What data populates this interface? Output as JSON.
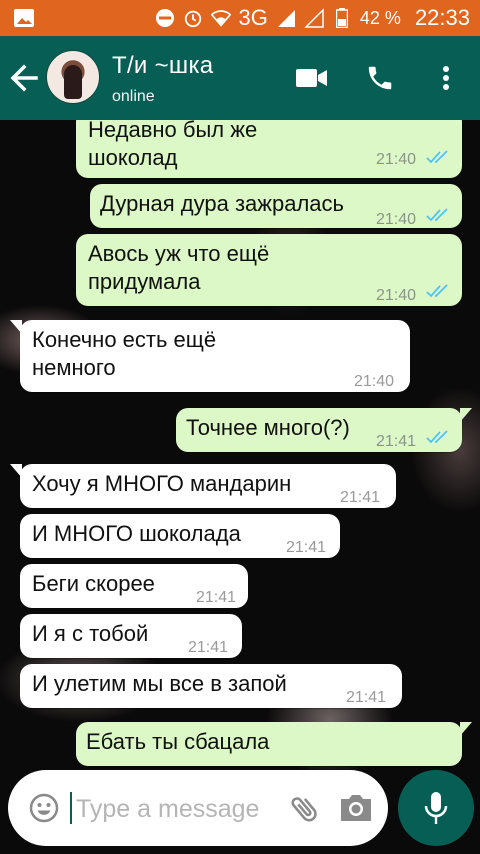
{
  "status_bar": {
    "icons": [
      "gallery-icon",
      "dnd-icon",
      "alarm-icon",
      "wifi-icon",
      "signal-icon",
      "signal-empty-icon",
      "battery-icon"
    ],
    "network": "3G",
    "battery": "42 %",
    "time": "22:33",
    "color": "#e0651f"
  },
  "header": {
    "name": "Т/и ~шка",
    "status": "online",
    "color": "#075e54"
  },
  "messages": [
    {
      "dir": "out",
      "text_lines": [
        "Недавно был же",
        "шоколад"
      ],
      "time": "21:40",
      "read": true
    },
    {
      "dir": "out",
      "text_lines": [
        "Дурная дура зажралась"
      ],
      "time": "21:40",
      "read": true
    },
    {
      "dir": "out",
      "text_lines": [
        "Авось уж что ещё",
        "придумала"
      ],
      "time": "21:40",
      "read": true
    },
    {
      "dir": "in",
      "text_lines": [
        "Конечно есть ещё",
        "немного"
      ],
      "time": "21:40"
    },
    {
      "dir": "out",
      "text_lines": [
        "Точнее много(?)"
      ],
      "time": "21:41",
      "read": true
    },
    {
      "dir": "in",
      "text_lines": [
        "Хочу я МНОГО мандарин"
      ],
      "time": "21:41"
    },
    {
      "dir": "in",
      "text_lines": [
        "И МНОГО шоколада"
      ],
      "time": "21:41"
    },
    {
      "dir": "in",
      "text_lines": [
        "Беги скорее"
      ],
      "time": "21:41"
    },
    {
      "dir": "in",
      "text_lines": [
        "И я с тобой"
      ],
      "time": "21:41"
    },
    {
      "dir": "in",
      "text_lines": [
        "И улетим мы все в запой"
      ],
      "time": "21:41"
    },
    {
      "dir": "out",
      "text_lines": [
        "Ебать ты сбацала"
      ],
      "time": "",
      "read": false
    }
  ],
  "composer": {
    "placeholder": "Type a message",
    "value": ""
  },
  "colors": {
    "outgoing_bubble": "#dcf8c6",
    "incoming_bubble": "#ffffff",
    "read_ticks": "#4fc3f7"
  }
}
